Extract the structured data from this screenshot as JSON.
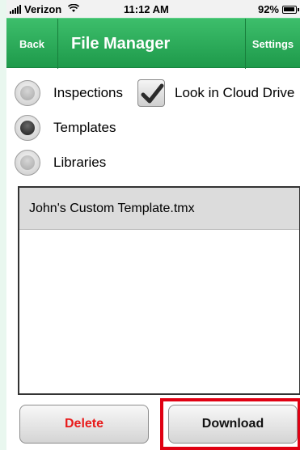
{
  "status_bar": {
    "carrier": "Verizon",
    "time": "11:12 AM",
    "battery": "92%"
  },
  "nav": {
    "back_label": "Back",
    "title": "File Manager",
    "settings_label": "Settings"
  },
  "options": {
    "inspections_label": "Inspections",
    "templates_label": "Templates",
    "libraries_label": "Libraries",
    "selected": "Templates",
    "cloud_label": "Look in Cloud Drive",
    "cloud_checked": true
  },
  "files": [
    "John's Custom Template.tmx"
  ],
  "actions": {
    "delete_label": "Delete",
    "download_label": "Download"
  },
  "colors": {
    "nav_green": "#2aae5a",
    "delete_red": "#e81a1a",
    "highlight_red": "#e00012"
  }
}
